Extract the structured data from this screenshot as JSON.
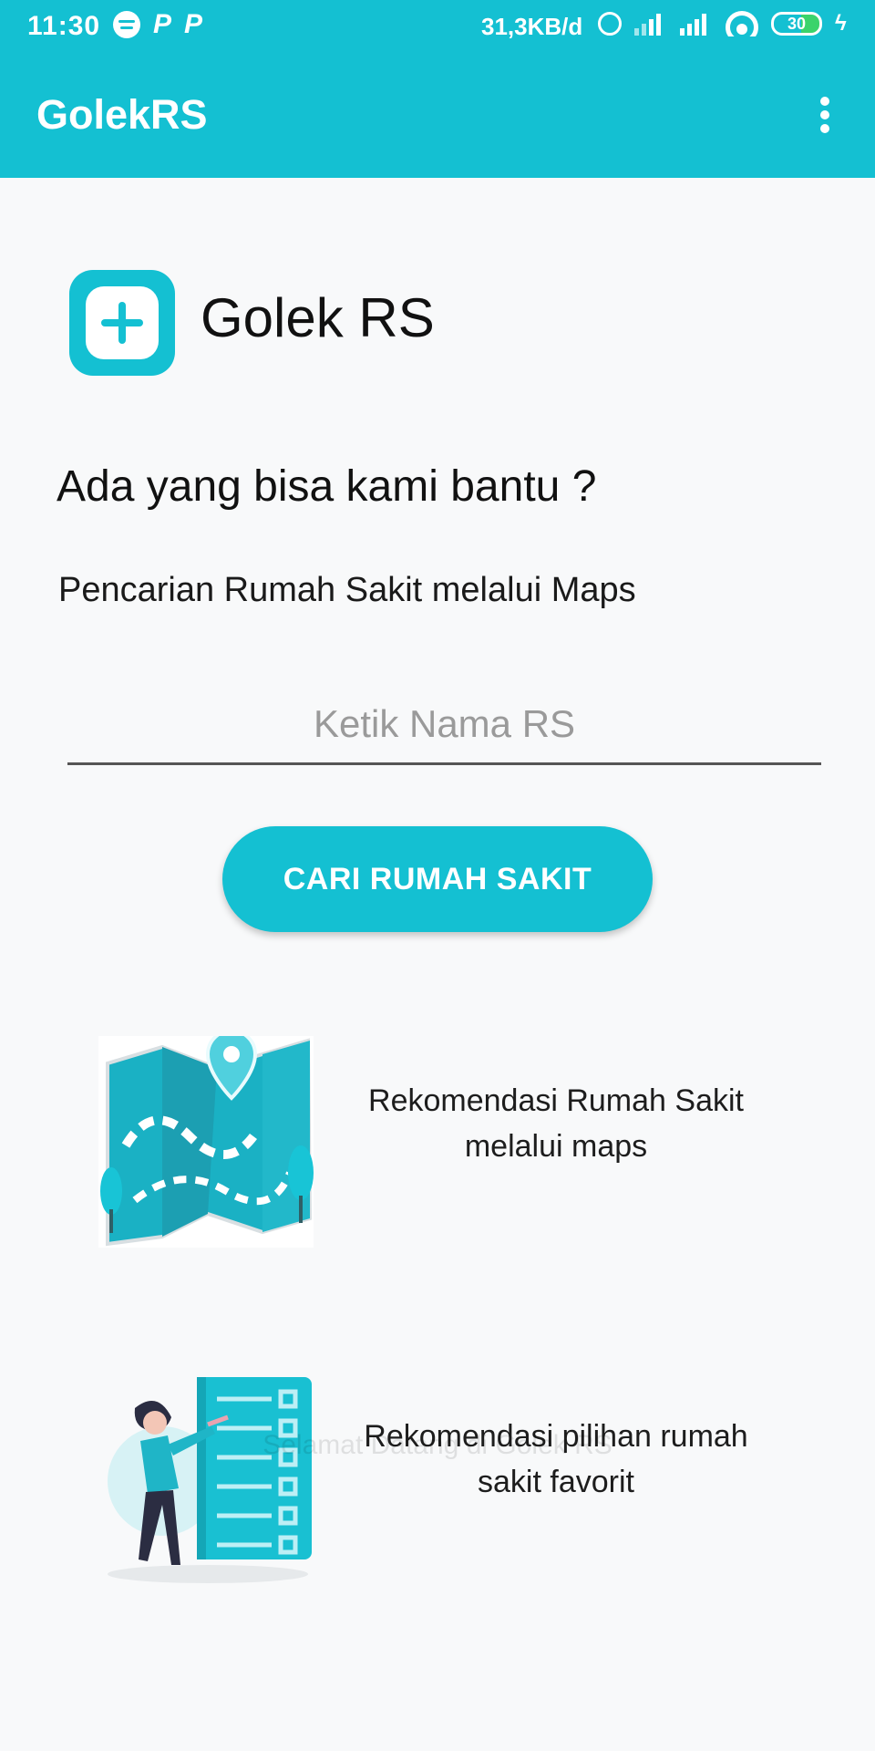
{
  "status_bar": {
    "time": "11:30",
    "speed": "31,3KB/d",
    "battery": "30",
    "left_icons": [
      "spotify-icon",
      "p-icon",
      "p-icon"
    ],
    "right_icons": [
      "alarm-icon",
      "signal-icon",
      "signal-icon",
      "wifi-icon",
      "battery-icon",
      "bolt-icon"
    ],
    "p_glyph": "P",
    "bolt_glyph": "ϟ"
  },
  "app_bar": {
    "title": "GolekRS",
    "menu_icon": "more-vert-icon"
  },
  "brand": {
    "name": "Golek RS",
    "logo_icon": "plus-icon"
  },
  "question": "Ada yang bisa kami bantu ?",
  "subtitle": "Pencarian Rumah Sakit melalui Maps",
  "search": {
    "placeholder": "Ketik Nama RS",
    "value": ""
  },
  "search_button_label": "CARI RUMAH SAKIT",
  "features": [
    {
      "icon": "map-illustration-icon",
      "text": "Rekomendasi Rumah Sakit melalui maps"
    },
    {
      "icon": "checklist-illustration-icon",
      "text": "Rekomendasi pilihan rumah sakit favorit"
    }
  ],
  "toast": "Selamat Datang di Golek RS",
  "colors": {
    "primary": "#14c0d2",
    "background": "#f8f9fa",
    "text": "#111111",
    "placeholder": "#9a9a9a"
  }
}
